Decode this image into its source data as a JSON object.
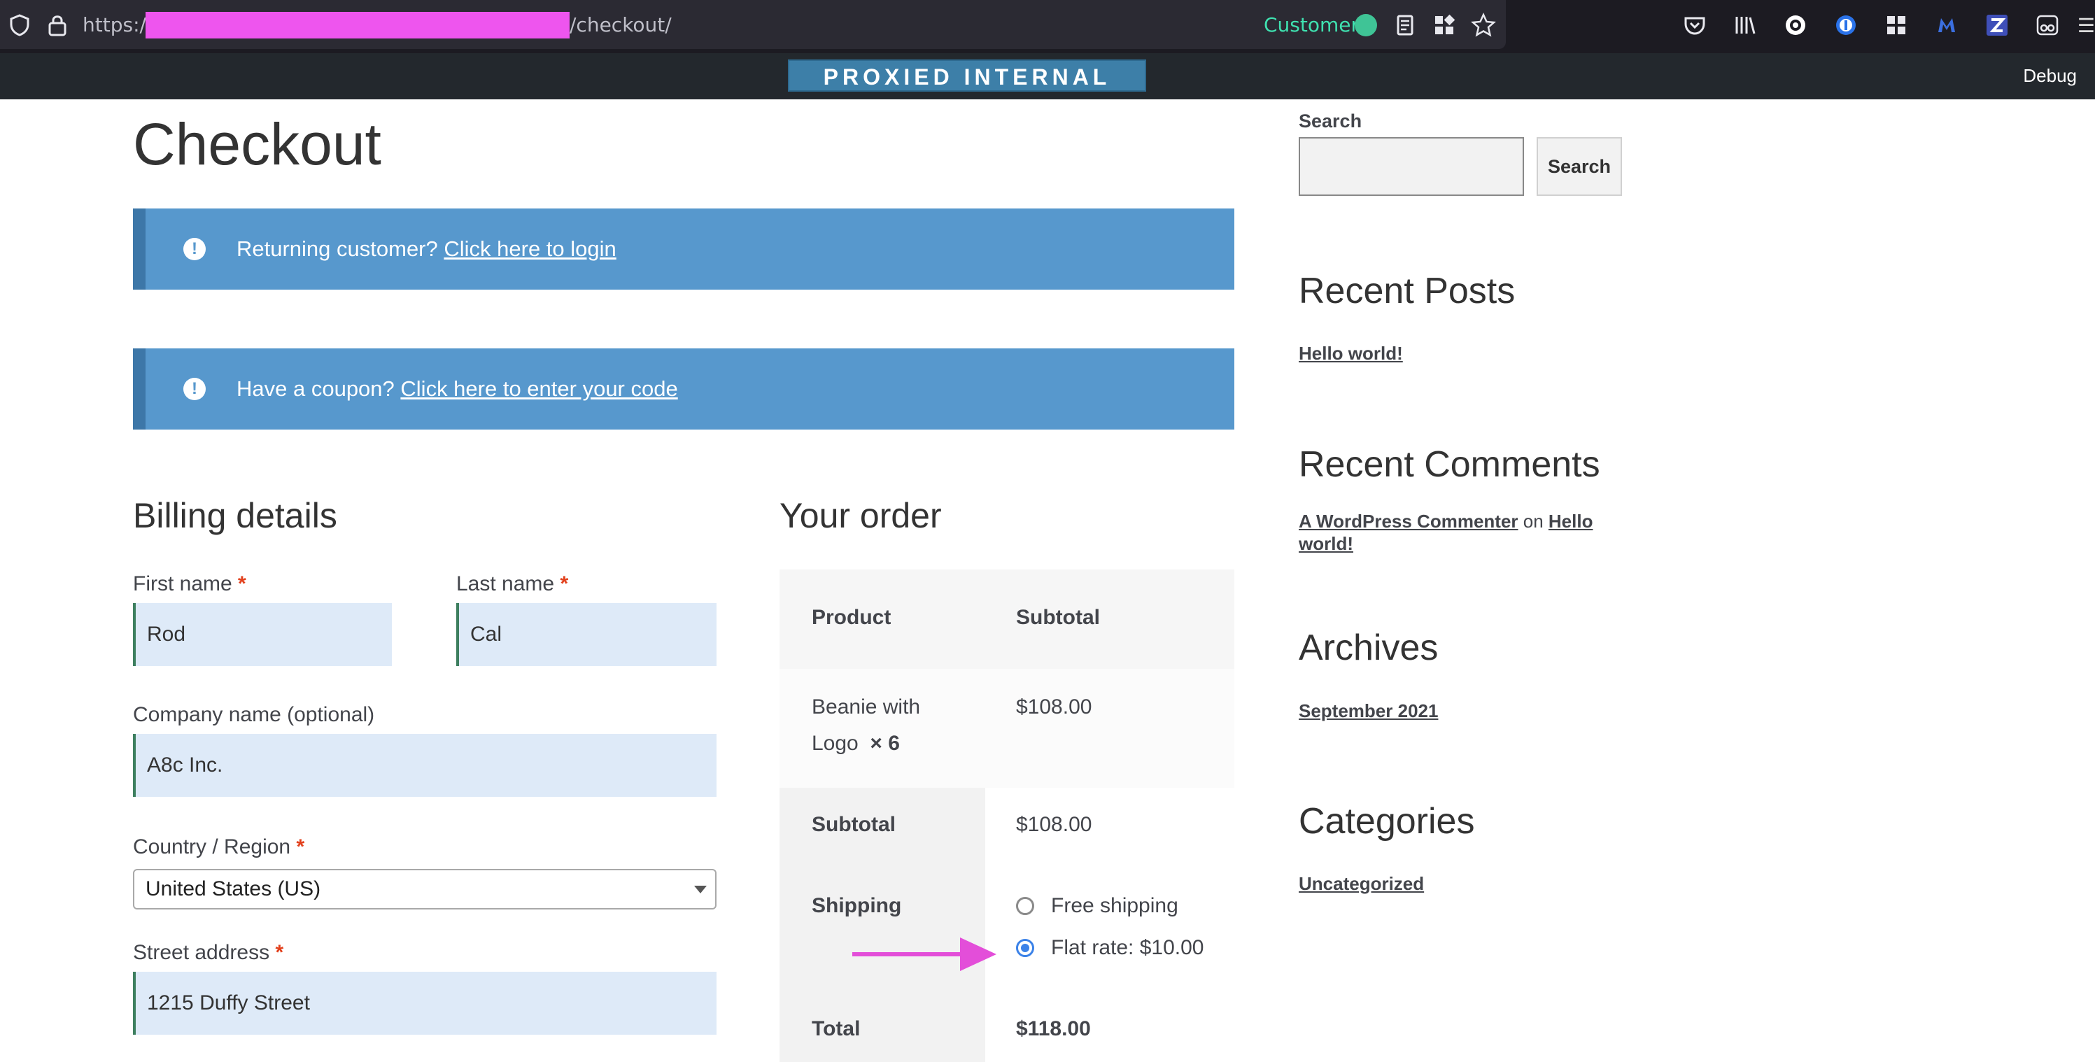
{
  "browser": {
    "url_prefix": "https://",
    "url_path": "/checkout/",
    "container_label": "Customer",
    "admin_banner": "PROXIED INTERNAL",
    "debug_label": "Debug",
    "overflow_glyph": "☰"
  },
  "page": {
    "title": "Checkout",
    "notice_login": {
      "text": "Returning customer? ",
      "link": "Click here to login"
    },
    "notice_coupon": {
      "text": "Have a coupon? ",
      "link": "Click here to enter your code"
    }
  },
  "billing": {
    "heading": "Billing details",
    "first_name": {
      "label": "First name",
      "value": "Rod"
    },
    "last_name": {
      "label": "Last name",
      "value": "Cal"
    },
    "company": {
      "label": "Company name (optional)",
      "value": "A8c Inc."
    },
    "country": {
      "label": "Country / Region",
      "value": "United States (US)"
    },
    "street": {
      "label": "Street address",
      "value": "1215 Duffy Street"
    },
    "required_mark": "*"
  },
  "order": {
    "heading": "Your order",
    "col_product": "Product",
    "col_subtotal": "Subtotal",
    "item_name_line1": "Beanie with",
    "item_name_line2": "Logo",
    "item_qty": "× 6",
    "item_price": "$108.00",
    "subtotal_label": "Subtotal",
    "subtotal_value": "$108.00",
    "shipping_label": "Shipping",
    "shipping_free": "Free shipping",
    "shipping_flat": "Flat rate: $10.00",
    "total_label": "Total",
    "total_value": "$118.00"
  },
  "sidebar": {
    "search_label": "Search",
    "search_button": "Search",
    "recent_posts_heading": "Recent Posts",
    "recent_post": "Hello world!",
    "recent_comments_heading": "Recent Comments",
    "comment_author": "A WordPress Commenter",
    "comment_on": " on ",
    "comment_post": "Hello world!",
    "archives_heading": "Archives",
    "archive_item": "September 2021",
    "categories_heading": "Categories",
    "category_item": "Uncategorized"
  },
  "colors": {
    "notice_bg": "#5798cd",
    "field_bg": "#deeaf8",
    "admin_bar": "#23282d",
    "annotation_arrow": "#e34ed9",
    "radio_selected": "#3b82e8"
  },
  "icons": [
    "shield-icon",
    "lock-icon",
    "reader-view-icon",
    "extensions-icon",
    "bookmark-star-icon",
    "pocket-icon",
    "library-icon",
    "1password-icon",
    "grid-icon",
    "malwarebytes-icon",
    "z-icon",
    "glasses-icon",
    "notice-exclamation-icon",
    "select-caret-icon",
    "pointer-arrow-icon"
  ]
}
